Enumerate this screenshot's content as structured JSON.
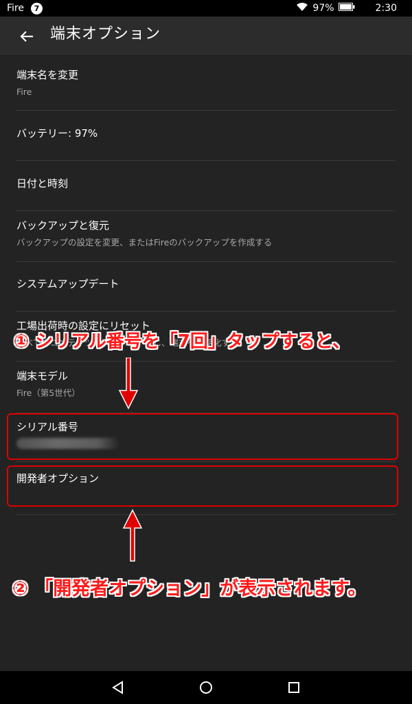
{
  "status_bar": {
    "carrier": "Fire",
    "notification_count": "7",
    "battery": "97%",
    "time": "2:30"
  },
  "header": {
    "title": "端末オプション"
  },
  "items": [
    {
      "title": "端末名を変更",
      "subtitle": "Fire"
    },
    {
      "title": "バッテリー: 97%"
    },
    {
      "title": "日付と時刻"
    },
    {
      "title": "バックアップと復元",
      "subtitle": "バックアップの設定を変更、またはFireのバックアップを作成する"
    },
    {
      "title": "システムアップデート"
    },
    {
      "title": "工場出荷時の設定にリセット",
      "subtitle": "すべてのコンテンツをダウンロードし、端末を初期化する"
    },
    {
      "title": "端末モデル",
      "subtitle": "Fire（第5世代）"
    },
    {
      "title": "シリアル番号"
    },
    {
      "title": "開発者オプション"
    }
  ],
  "annotations": {
    "step1": "① シリアル番号を「7回」タップすると、",
    "step2": "② 「開発者オプション」が表示されます。"
  },
  "colors": {
    "background": "#232323",
    "appbar": "#2c2c2c",
    "annotation_red": "#e00000"
  }
}
